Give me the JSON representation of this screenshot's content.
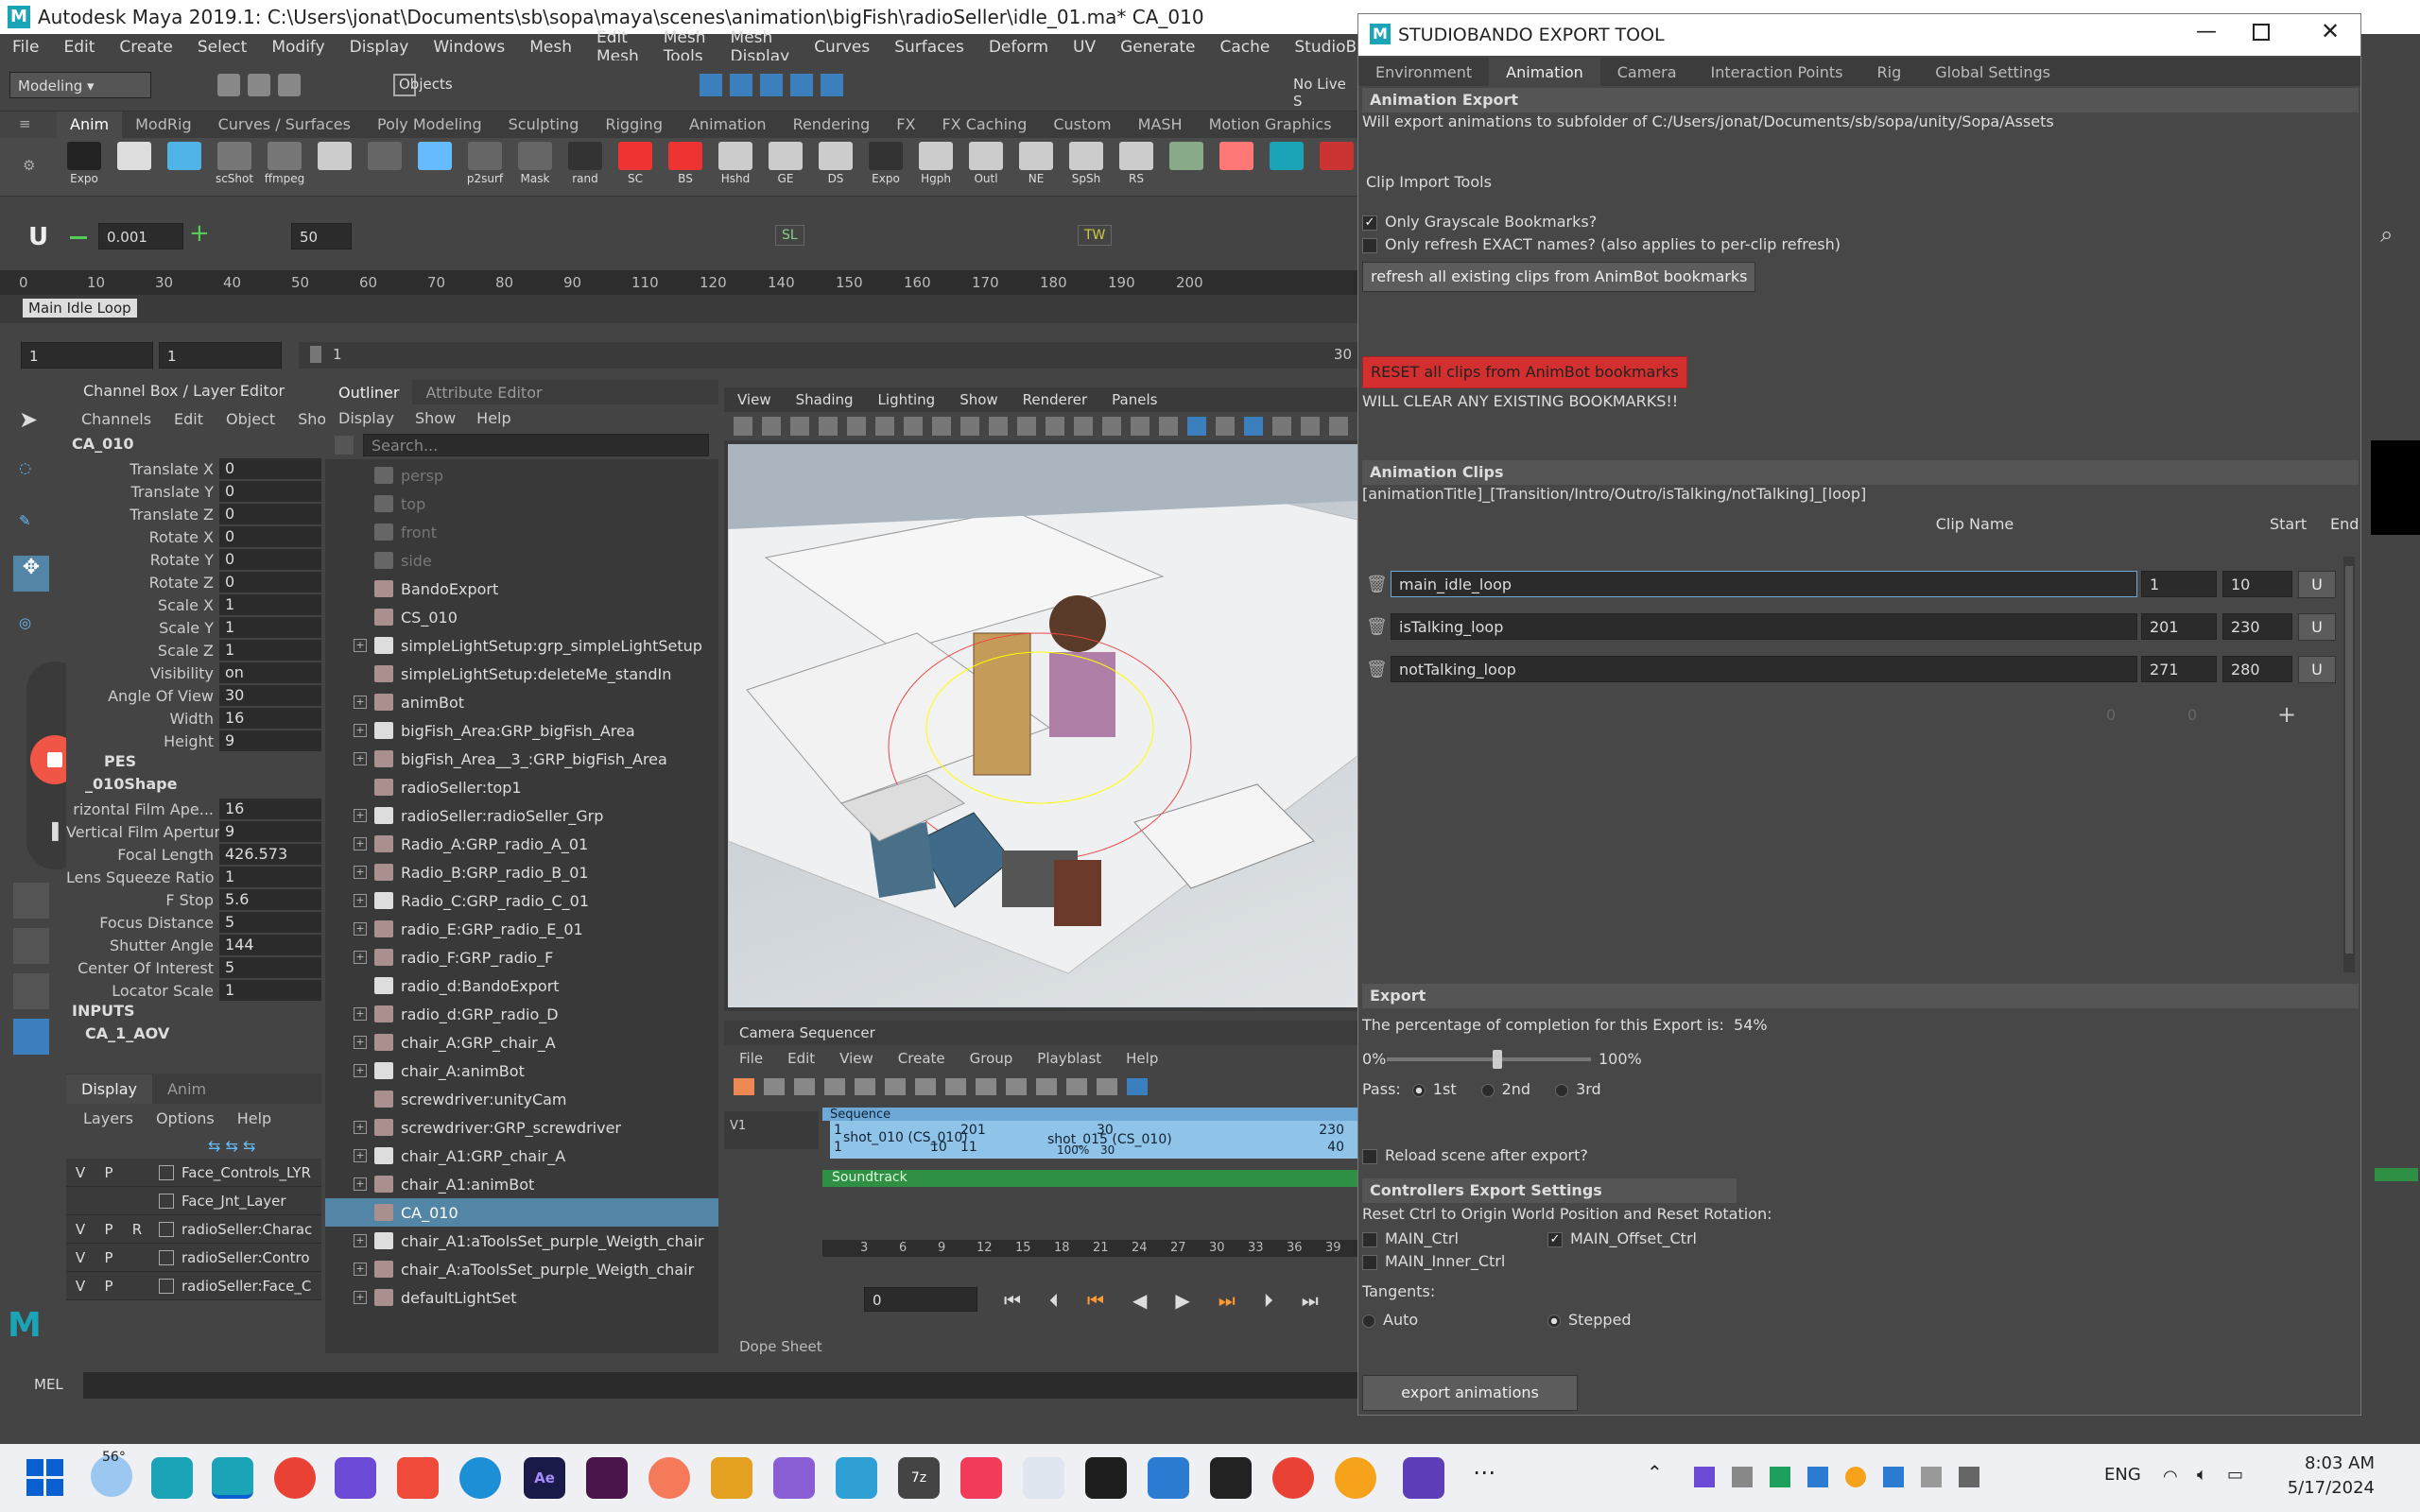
{
  "window": {
    "title": "Autodesk Maya 2019.1: C:\\Users\\jonat\\Documents\\sb\\sopa\\maya\\scenes\\animation\\bigFish\\radioSeller\\idle_01.ma*    CA_010"
  },
  "menus": [
    "File",
    "Edit",
    "Create",
    "Select",
    "Modify",
    "Display",
    "Windows",
    "Mesh",
    "Edit Mesh",
    "Mesh Tools",
    "Mesh Display",
    "Curves",
    "Surfaces",
    "Deform",
    "UV",
    "Generate",
    "Cache",
    "StudioBando"
  ],
  "status_line": {
    "mode": "Modeling",
    "objects_label": "Objects",
    "no_live": "No Live S"
  },
  "shelf_tabs": [
    "Anim",
    "ModRig",
    "Curves / Surfaces",
    "Poly Modeling",
    "Sculpting",
    "Rigging",
    "Animation",
    "Rendering",
    "FX",
    "FX Caching",
    "Custom",
    "MASH",
    "Motion Graphics"
  ],
  "shelf_icons": [
    "Expo",
    "",
    "",
    "scShot",
    "ffmpeg",
    "",
    "",
    "",
    "p2surf",
    "Mask",
    "rand",
    "SC",
    "BS",
    "Hshd",
    "GE",
    "DS",
    "Expo",
    "Hgph",
    "Outl",
    "NE",
    "SpSh",
    "RS",
    "",
    "",
    "",
    ""
  ],
  "anim_controls": {
    "value1": "0.001",
    "value2": "50",
    "sl": "SL",
    "tw": "TW"
  },
  "timeline": {
    "ticks": [
      "0",
      "10",
      "30",
      "40",
      "50",
      "60",
      "70",
      "80",
      "90",
      "110",
      "120",
      "140",
      "150",
      "160",
      "170",
      "180",
      "190",
      "200"
    ],
    "bookmark": "Main Idle Loop"
  },
  "range": {
    "start": "1",
    "start2": "1",
    "inner": "1",
    "end": "30"
  },
  "channel_box": {
    "title": "Channel Box / Layer Editor",
    "menu": [
      "Channels",
      "Edit",
      "Object",
      "Show"
    ],
    "object": "CA_010",
    "attrs": [
      {
        "l": "Translate X",
        "v": "0"
      },
      {
        "l": "Translate Y",
        "v": "0"
      },
      {
        "l": "Translate Z",
        "v": "0"
      },
      {
        "l": "Rotate X",
        "v": "0"
      },
      {
        "l": "Rotate Y",
        "v": "0"
      },
      {
        "l": "Rotate Z",
        "v": "0"
      },
      {
        "l": "Scale X",
        "v": "1"
      },
      {
        "l": "Scale Y",
        "v": "1"
      },
      {
        "l": "Scale Z",
        "v": "1"
      },
      {
        "l": "Visibility",
        "v": "on"
      },
      {
        "l": "Angle Of View",
        "v": "30"
      },
      {
        "l": "Width",
        "v": "16"
      },
      {
        "l": "Height",
        "v": "9"
      }
    ],
    "shapes_label": "PES",
    "shape_name": "_010Shape",
    "shape_attrs": [
      {
        "l": "rizontal Film Ape...",
        "v": "16"
      },
      {
        "l": "Vertical Film Aperture",
        "v": "9"
      },
      {
        "l": "Focal Length",
        "v": "426.573"
      },
      {
        "l": "Lens Squeeze Ratio",
        "v": "1"
      },
      {
        "l": "F Stop",
        "v": "5.6"
      },
      {
        "l": "Focus Distance",
        "v": "5"
      },
      {
        "l": "Shutter Angle",
        "v": "144"
      },
      {
        "l": "Center Of Interest",
        "v": "5"
      },
      {
        "l": "Locator Scale",
        "v": "1"
      }
    ],
    "inputs_label": "INPUTS",
    "input_name": "CA_1_AOV",
    "layer_tabs": [
      "Display",
      "Anim"
    ],
    "layer_menu": [
      "Layers",
      "Options",
      "Help"
    ],
    "layers": [
      {
        "v": "V",
        "p": "P",
        "r": "",
        "n": "Face_Controls_LYR"
      },
      {
        "v": "",
        "p": "",
        "r": "",
        "n": "Face_Jnt_Layer"
      },
      {
        "v": "V",
        "p": "P",
        "r": "R",
        "n": "radioSeller:Charac"
      },
      {
        "v": "V",
        "p": "P",
        "r": "",
        "n": "radioSeller:Contro"
      },
      {
        "v": "V",
        "p": "P",
        "r": "",
        "n": "radioSeller:Face_C"
      }
    ]
  },
  "outliner": {
    "tabs": [
      "Outliner",
      "Attribute Editor"
    ],
    "menu": [
      "Display",
      "Show",
      "Help"
    ],
    "search_placeholder": "Search...",
    "items": [
      {
        "n": "persp",
        "p": false,
        "d": true
      },
      {
        "n": "top",
        "p": false,
        "d": true
      },
      {
        "n": "front",
        "p": false,
        "d": true
      },
      {
        "n": "side",
        "p": false,
        "d": true
      },
      {
        "n": "BandoExport",
        "p": false
      },
      {
        "n": "CS_010",
        "p": false
      },
      {
        "n": "simpleLightSetup:grp_simpleLightSetup",
        "p": true
      },
      {
        "n": "simpleLightSetup:deleteMe_standIn",
        "p": false
      },
      {
        "n": "animBot",
        "p": true
      },
      {
        "n": "bigFish_Area:GRP_bigFish_Area",
        "p": true
      },
      {
        "n": "bigFish_Area__3_:GRP_bigFish_Area",
        "p": true
      },
      {
        "n": "radioSeller:top1",
        "p": false
      },
      {
        "n": "radioSeller:radioSeller_Grp",
        "p": true
      },
      {
        "n": "Radio_A:GRP_radio_A_01",
        "p": true
      },
      {
        "n": "Radio_B:GRP_radio_B_01",
        "p": true
      },
      {
        "n": "Radio_C:GRP_radio_C_01",
        "p": true
      },
      {
        "n": "radio_E:GRP_radio_E_01",
        "p": true
      },
      {
        "n": "radio_F:GRP_radio_F",
        "p": true
      },
      {
        "n": "radio_d:BandoExport",
        "p": false
      },
      {
        "n": "radio_d:GRP_radio_D",
        "p": true
      },
      {
        "n": "chair_A:GRP_chair_A",
        "p": true
      },
      {
        "n": "chair_A:animBot",
        "p": true
      },
      {
        "n": "screwdriver:unityCam",
        "p": false
      },
      {
        "n": "screwdriver:GRP_screwdriver",
        "p": true
      },
      {
        "n": "chair_A1:GRP_chair_A",
        "p": true
      },
      {
        "n": "chair_A1:animBot",
        "p": true
      },
      {
        "n": "CA_010",
        "p": false,
        "s": true
      },
      {
        "n": "chair_A1:aToolsSet_purple_Weigth_chair",
        "p": true
      },
      {
        "n": "chair_A:aToolsSet_purple_Weigth_chair",
        "p": true
      },
      {
        "n": "defaultLightSet",
        "p": true
      }
    ]
  },
  "viewport": {
    "menu": [
      "View",
      "Shading",
      "Lighting",
      "Show",
      "Renderer",
      "Panels"
    ]
  },
  "sequencer": {
    "title": "Camera Sequencer",
    "menu": [
      "File",
      "Edit",
      "View",
      "Create",
      "Group",
      "Playblast",
      "Help"
    ],
    "sequence_label": "Sequence",
    "shot1": "shot_010 (CS_010)",
    "shot1_start": "1",
    "shot1_end": "10",
    "shot1_len": "10",
    "shot2": "shot_015 (CS_010)",
    "shot2_start": "201",
    "shot2_end": "230",
    "shot2_a": "11",
    "shot2_b": "30",
    "shot2_c": "40",
    "shot2_pct": "100%",
    "shot2_mid": "30",
    "soundtrack": "Soundtrack",
    "track": "V1",
    "ticks": [
      "3",
      "6",
      "9",
      "12",
      "15",
      "18",
      "21",
      "24",
      "27",
      "30",
      "33",
      "36",
      "39"
    ],
    "frame": "0",
    "dope_sheet": "Dope Sheet"
  },
  "mel": {
    "label": "MEL"
  },
  "export_tool": {
    "title": "STUDIOBANDO EXPORT TOOL",
    "tabs": [
      "Environment",
      "Animation",
      "Camera",
      "Interaction Points",
      "Rig",
      "Global Settings"
    ],
    "anim_export_header": "Animation Export",
    "export_path": "Will export animations to subfolder of C:/Users/jonat/Documents/sb/sopa/unity/Sopa/Assets",
    "clip_import_tools": "Clip Import Tools",
    "only_grayscale": "Only Grayscale Bookmarks?",
    "only_refresh": "Only refresh EXACT names? (also applies to per-clip refresh)",
    "refresh_btn": "refresh all existing clips from AnimBot bookmarks",
    "reset_btn": "RESET all clips from AnimBot bookmarks",
    "reset_warning": "WILL CLEAR ANY EXISTING BOOKMARKS!!",
    "clips_header": "Animation Clips",
    "naming_hint": "[animationTitle]_[Transition/Intro/Outro/isTalking/notTalking]_[loop]",
    "col_clip": "Clip Name",
    "col_start": "Start",
    "col_end": "End",
    "clips": [
      {
        "name": "main_idle_loop",
        "start": "1",
        "end": "10",
        "btn": "U"
      },
      {
        "name": "isTalking_loop",
        "start": "201",
        "end": "230",
        "btn": "U"
      },
      {
        "name": "notTalking_loop",
        "start": "271",
        "end": "280",
        "btn": "U"
      }
    ],
    "empty_start": "0",
    "empty_end": "0",
    "export_header": "Export",
    "completion_text": "The percentage of completion for this Export is:",
    "completion_pct": "54%",
    "completion_value": 0.54,
    "slider_min": "0%",
    "slider_max": "100%",
    "pass_label": "Pass:",
    "passes": [
      "1st",
      "2nd",
      "3rd"
    ],
    "reload_scene": "Reload scene after export?",
    "controllers_header": "Controllers Export Settings",
    "reset_ctrl_text": "Reset Ctrl to Origin World Position and Reset Rotation:",
    "main_ctrl": "MAIN_Ctrl",
    "main_offset_ctrl": "MAIN_Offset_Ctrl",
    "main_inner_ctrl": "MAIN_Inner_Ctrl",
    "tangents_label": "Tangents:",
    "auto": "Auto",
    "stepped": "Stepped",
    "export_btn": "export animations"
  },
  "taskbar": {
    "weather": "56°",
    "lang": "ENG",
    "time": "8:03 AM",
    "date": "5/17/2024"
  },
  "colors": {
    "accent_red": "#d32f2f",
    "selection_blue": "#5285a6",
    "maya_teal": "#1ba3b8"
  }
}
